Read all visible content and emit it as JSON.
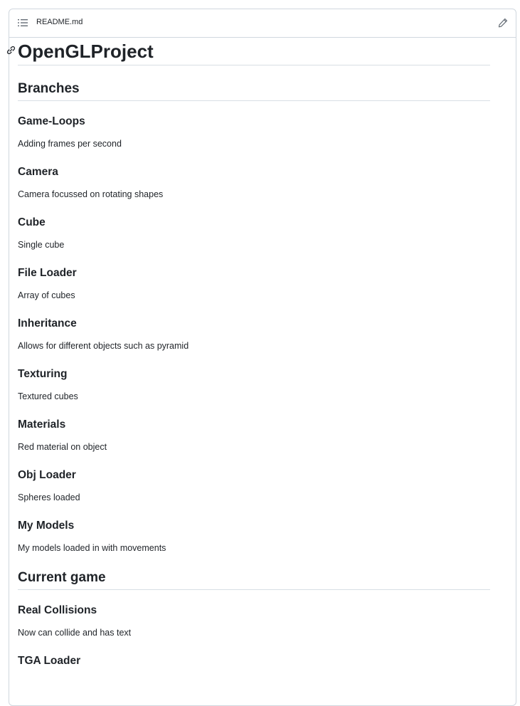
{
  "header": {
    "file_name": "README.md",
    "outline_icon": "list-unordered-icon",
    "edit_icon": "pencil-icon"
  },
  "readme": {
    "title": "OpenGLProject",
    "sections": [
      {
        "heading": "Branches",
        "items": [
          {
            "heading": "Game-Loops",
            "text": "Adding frames per second"
          },
          {
            "heading": "Camera",
            "text": "Camera focussed on rotating shapes"
          },
          {
            "heading": "Cube",
            "text": "Single cube"
          },
          {
            "heading": "File Loader",
            "text": "Array of cubes"
          },
          {
            "heading": "Inheritance",
            "text": "Allows for different objects such as pyramid"
          },
          {
            "heading": "Texturing",
            "text": "Textured cubes"
          },
          {
            "heading": "Materials",
            "text": "Red material on object"
          },
          {
            "heading": "Obj Loader",
            "text": "Spheres loaded"
          },
          {
            "heading": "My Models",
            "text": "My models loaded in with movements"
          }
        ]
      },
      {
        "heading": "Current game",
        "items": [
          {
            "heading": "Real Collisions",
            "text": "Now can collide and has text"
          },
          {
            "heading": "TGA Loader",
            "text": ""
          }
        ]
      }
    ]
  }
}
